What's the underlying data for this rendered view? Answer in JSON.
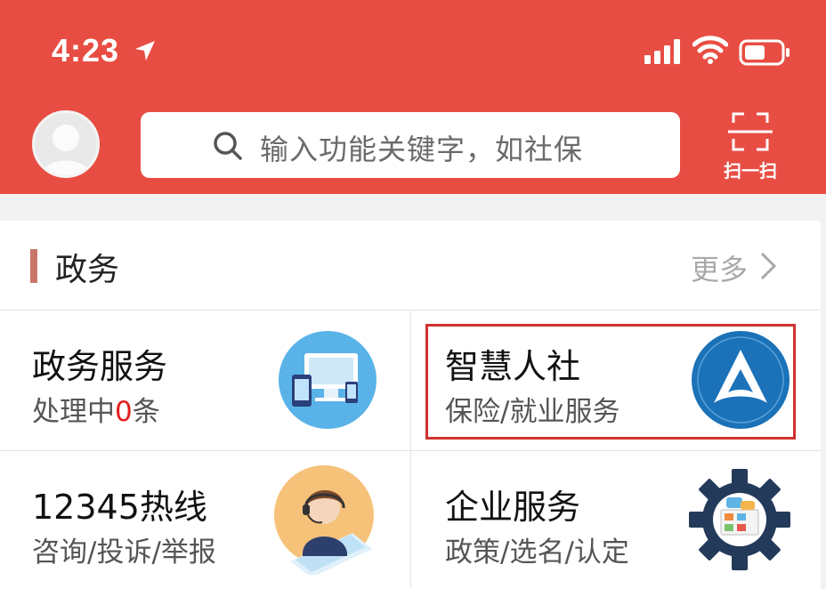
{
  "status_bar": {
    "time": "4:23"
  },
  "header": {
    "search_placeholder": "输入功能关键字，如社保",
    "scan_label": "扫一扫"
  },
  "section": {
    "title": "政务",
    "more_label": "更多"
  },
  "tiles": [
    {
      "title": "政务服务",
      "sub_prefix": "处理中",
      "sub_count": "0",
      "sub_suffix": "条"
    },
    {
      "title": "智慧人社",
      "sub": "保险/就业服务"
    },
    {
      "title": "12345热线",
      "sub": "咨询/投诉/举报"
    },
    {
      "title": "企业服务",
      "sub": "政策/选名/认定"
    }
  ],
  "colors": {
    "header_red": "#e84d43",
    "accent_bar": "#c8766a",
    "highlight_red": "#d0322f",
    "count_red": "#e21d1d"
  }
}
